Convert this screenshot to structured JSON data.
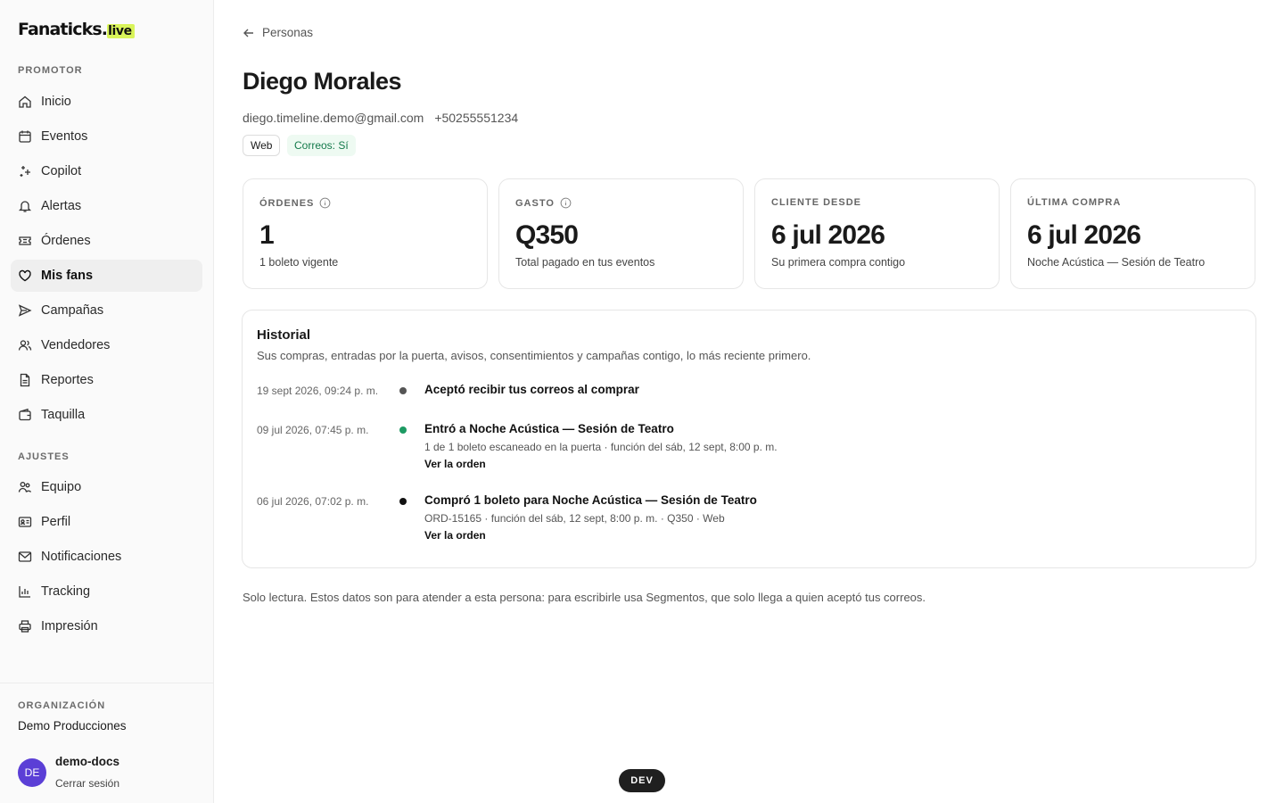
{
  "brand": {
    "name": "Fanaticks.",
    "suffix": "live",
    "accent": "#d9f45a"
  },
  "sidebar": {
    "sections": [
      {
        "label": "PROMOTOR",
        "items": [
          {
            "label": "Inicio",
            "icon": "home-icon"
          },
          {
            "label": "Eventos",
            "icon": "calendar-icon"
          },
          {
            "label": "Copilot",
            "icon": "sparkles-icon"
          },
          {
            "label": "Alertas",
            "icon": "bell-icon"
          },
          {
            "label": "Órdenes",
            "icon": "ticket-icon"
          },
          {
            "label": "Mis fans",
            "icon": "heart-icon",
            "active": true
          },
          {
            "label": "Campañas",
            "icon": "send-icon"
          },
          {
            "label": "Vendedores",
            "icon": "users-icon"
          },
          {
            "label": "Reportes",
            "icon": "file-icon"
          },
          {
            "label": "Taquilla",
            "icon": "wallet-icon"
          }
        ]
      },
      {
        "label": "AJUSTES",
        "items": [
          {
            "label": "Equipo",
            "icon": "team-icon"
          },
          {
            "label": "Perfil",
            "icon": "id-card-icon"
          },
          {
            "label": "Notificaciones",
            "icon": "mail-icon"
          },
          {
            "label": "Tracking",
            "icon": "chart-icon"
          },
          {
            "label": "Impresión",
            "icon": "printer-icon"
          }
        ]
      }
    ],
    "org_label": "ORGANIZACIÓN",
    "org_name": "Demo Producciones",
    "user": {
      "initials": "DE",
      "name": "demo-docs",
      "logout": "Cerrar sesión",
      "avatar_color": "#5b3fd6"
    }
  },
  "breadcrumb": {
    "back_label": "Personas"
  },
  "person": {
    "name": "Diego Morales",
    "email": "diego.timeline.demo@gmail.com",
    "phone": "+50255551234",
    "channel_badge": "Web",
    "mail_badge": "Correos: Sí"
  },
  "stats": [
    {
      "label": "ÓRDENES",
      "value": "1",
      "sub": "1 boleto vigente",
      "info": true
    },
    {
      "label": "GASTO",
      "value": "Q350",
      "sub": "Total pagado en tus eventos",
      "info": true
    },
    {
      "label": "CLIENTE DESDE",
      "value": "6 jul 2026",
      "sub": "Su primera compra contigo",
      "info": false
    },
    {
      "label": "ÚLTIMA COMPRA",
      "value": "6 jul 2026",
      "sub": "Noche Acústica — Sesión de Teatro",
      "info": false
    }
  ],
  "history": {
    "title": "Historial",
    "subtitle": "Sus compras, entradas por la puerta, avisos, consentimientos y campañas contigo, lo más reciente primero.",
    "events": [
      {
        "date": "19 sept 2026, 09:24 p. m.",
        "title": "Aceptó recibir tus correos al comprar",
        "detail": "",
        "link": "",
        "dot_color": "#555555"
      },
      {
        "date": "09 jul 2026, 07:45 p. m.",
        "title": "Entró a Noche Acústica — Sesión de Teatro",
        "detail": "1 de 1 boleto escaneado en la puerta · función del sáb, 12 sept, 8:00 p. m.",
        "link": "Ver la orden",
        "dot_color": "#1d9a63"
      },
      {
        "date": "06 jul 2026, 07:02 p. m.",
        "title": "Compró 1 boleto para Noche Acústica — Sesión de Teatro",
        "detail": "ORD-15165 · función del sáb, 12 sept, 8:00 p. m. · Q350 · Web",
        "link": "Ver la orden",
        "dot_color": "#111111"
      }
    ]
  },
  "footer_note": "Solo lectura. Estos datos son para atender a esta persona: para escribirle usa Segmentos, que solo llega a quien aceptó tus correos.",
  "env_badge": "DEV"
}
